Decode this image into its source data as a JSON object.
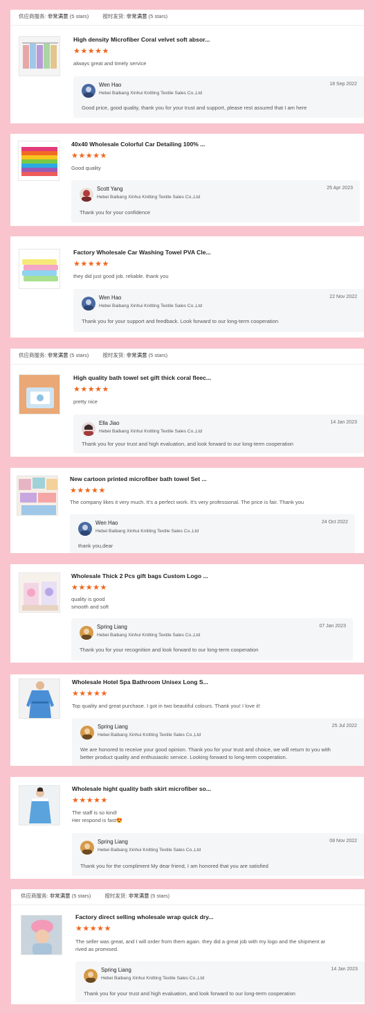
{
  "service_bar": {
    "supplier_label": "供应商服务:",
    "supplier_value": "非常满意",
    "supplier_stars": "(5 stars)",
    "delivery_label": "按时发货:",
    "delivery_value": "非常满意",
    "delivery_stars": "(5 stars)"
  },
  "rating_stars": "★★★★★",
  "reviews": [
    {
      "title": "High density Microfiber Coral velvet soft absor...",
      "text": "always great and timely service",
      "reply_name": "Wen Hao",
      "reply_company": "Hebei Baibang Xinhui Knitting Textile Sales Co.,Ltd",
      "reply_date": "18 Sep 2022",
      "reply_text": "Good price, good quality, thank you for your trust and support, please rest assured that I am here"
    },
    {
      "title": "40x40 Wholesale Colorful Car Detailing 100% ...",
      "text": "Good quality",
      "reply_name": "Scott Yang",
      "reply_company": "Hebei Baibang Xinhui Knitting Textile Sales Co.,Ltd",
      "reply_date": "25 Apr 2023",
      "reply_text": "Thank you for your confidence"
    },
    {
      "title": "Factory Wholesale Car Washing Towel PVA Cle...",
      "text": "they did just good job. reliable. thank you",
      "reply_name": "Wen Hao",
      "reply_company": "Hebei Baibang Xinhui Knitting Textile Sales Co.,Ltd",
      "reply_date": "22 Nov 2022",
      "reply_text": "Thank you for your support and feedback. Look forward to our long-term cooperation"
    },
    {
      "title": "High quality bath towel set gift thick coral fleec...",
      "text": "pretty nice",
      "reply_name": "Ella Jiao",
      "reply_company": "Hebei Baibang Xinhui Knitting Textile Sales Co.,Ltd",
      "reply_date": "14 Jan 2023",
      "reply_text": "Thank you for your trust and high evaluation, and look forward to our long-term cooperation"
    },
    {
      "title": "New cartoon printed microfiber bath towel Set ...",
      "text": "The company likes it very much. It's a perfect work. It's very professional. The price is fair. Thank you",
      "reply_name": "Wen Hao",
      "reply_company": "Hebei Baibang Xinhui Knitting Textile Sales Co.,Ltd",
      "reply_date": "24 Oct 2022",
      "reply_text": "thank you,dear"
    },
    {
      "title": "Wholesale Thick 2 Pcs gift bags Custom Logo ...",
      "text": "quality is good",
      "text2": "smooth and soft",
      "reply_name": "Spring Liang",
      "reply_company": "Hebei Baibang Xinhui Knitting Textile Sales Co.,Ltd",
      "reply_date": "07 Jan 2023",
      "reply_text": "Thank you for your recognition and look forward to our long-term cooperation"
    },
    {
      "title": "Wholesale Hotel Spa Bathroom Unisex Long S...",
      "text": "Top quality and great purchase. I got in two beautiful colours. Thank you! I love it!",
      "reply_name": "Spring Liang",
      "reply_company": "Hebei Baibang Xinhui Knitting Textile Sales Co.,Ltd",
      "reply_date": "25 Jul 2022",
      "reply_text": "We are honored to receive your good opinion. Thank you for your trust and choice, we will return to you with",
      "reply_text2": "better product quality and enthusiastic service. Looking forward to long-term cooperation."
    },
    {
      "title": "Wholesale hight quality bath skirt microfiber so...",
      "text": "The staff is so kind!",
      "text2": "Her respond is fast😍",
      "reply_name": "Spring Liang",
      "reply_company": "Hebei Baibang Xinhui Knitting Textile Sales Co.,Ltd",
      "reply_date": "08 Nov 2022",
      "reply_text": "Thank you for the compliment My dear friend, I am honored that you are satisfied"
    },
    {
      "title": "Factory direct selling wholesale wrap quick dry...",
      "text": "The seller was great, and I will order from them again. they did a great job with my logo and the shipment ar",
      "text2": "rived as promised.",
      "reply_name": "Spring Liang",
      "reply_company": "Hebei Baibang Xinhui Knitting Textile Sales Co.,Ltd",
      "reply_date": "14 Jan 2023",
      "reply_text": "Thank you for your trust and high evaluation, and look forward to our long-term cooperation"
    }
  ]
}
